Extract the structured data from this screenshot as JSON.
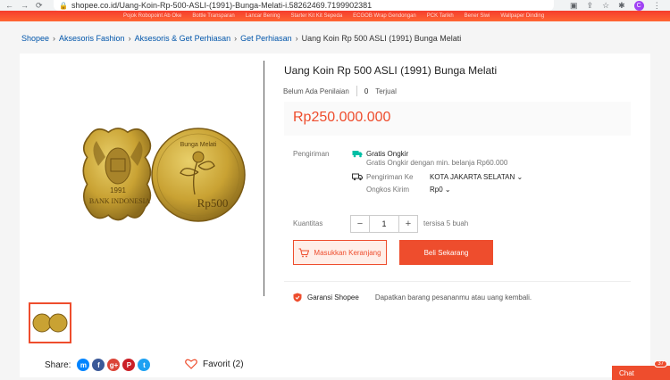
{
  "browser": {
    "url": "shopee.co.id/Uang-Koin-Rp-500-ASLI-(1991)-Bunga-Melati-i.58262469.7199902381",
    "profile_initial": "C"
  },
  "topbar_links": [
    "Pojok Robopoint Ab Oke",
    "Bottle Transparan",
    "Lancar Bening",
    "Starter Kit Kit Sepeda",
    "ECGOB Wrap Gendongan",
    "PCK Tarikh",
    "Bener Siwi",
    "Wallpaper Dinding"
  ],
  "breadcrumb": [
    "Shopee",
    "Aksesoris Fashion",
    "Aksesoris & Get Perhiasan",
    "Get Perhiasan"
  ],
  "breadcrumb_current": "Uang Koin Rp 500 ASLI (1991) Bunga Melati",
  "product": {
    "title": "Uang Koin Rp 500 ASLI (1991) Bunga Melati",
    "rating": "Belum Ada Penilaian",
    "sold_count": "0",
    "sold_label": "Terjual",
    "price": "Rp250.000.000",
    "coin_obverse_year": "1991",
    "coin_obverse_text": "BANK INDONESIA",
    "coin_reverse_top": "Bunga Melati",
    "coin_reverse_value": "Rp500"
  },
  "shipping": {
    "label": "Pengiriman",
    "free_title": "Gratis Ongkir",
    "free_desc": "Gratis Ongkir dengan min. belanja Rp60.000",
    "to_label": "Pengiriman Ke",
    "to_value": "KOTA JAKARTA SELATAN",
    "cost_label": "Ongkos Kirim",
    "cost_value": "Rp0"
  },
  "quantity": {
    "label": "Kuantitas",
    "minus": "−",
    "value": "1",
    "plus": "+",
    "stock": "tersisa 5 buah"
  },
  "buttons": {
    "add_to_cart": "Masukkan Keranjang",
    "buy_now": "Beli Sekarang"
  },
  "guarantee": {
    "title": "Garansi Shopee",
    "desc": "Dapatkan barang pesananmu atau uang kembali."
  },
  "share": {
    "label": "Share:",
    "icons": [
      "messenger-icon",
      "facebook-icon",
      "google-plus-icon",
      "pinterest-icon",
      "twitter-icon"
    ]
  },
  "favorite": "Favorit (2)",
  "chat": {
    "label": "Chat",
    "badge": "37"
  },
  "colors": {
    "accent": "#ee4d2d",
    "coin_gold": "#c9a233"
  }
}
